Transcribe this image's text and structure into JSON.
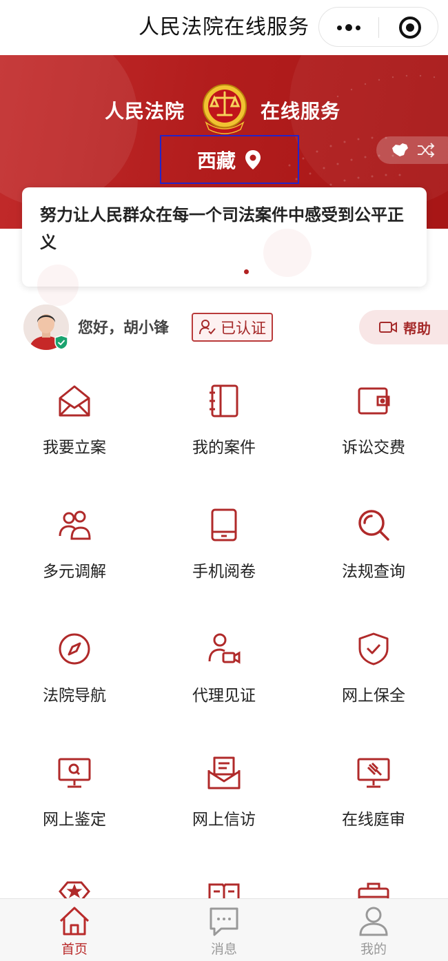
{
  "navbar": {
    "title": "人民法院在线服务"
  },
  "banner": {
    "title_left": "人民法院",
    "title_right": "在线服务",
    "location": "西藏"
  },
  "slogan": {
    "text": "努力让人民群众在每一个司法案件中感受到公平正义"
  },
  "user": {
    "greeting": "您好，胡小锋",
    "auth_status": "已认证",
    "help_label": "帮助"
  },
  "services": [
    {
      "label": "我要立案",
      "icon": "envelope-icon"
    },
    {
      "label": "我的案件",
      "icon": "notebook-icon"
    },
    {
      "label": "诉讼交费",
      "icon": "wallet-icon"
    },
    {
      "label": "多元调解",
      "icon": "people-icon"
    },
    {
      "label": "手机阅卷",
      "icon": "tablet-icon"
    },
    {
      "label": "法规查询",
      "icon": "magnifier-icon"
    },
    {
      "label": "法院导航",
      "icon": "compass-icon"
    },
    {
      "label": "代理见证",
      "icon": "person-video-icon"
    },
    {
      "label": "网上保全",
      "icon": "shield-check-icon"
    },
    {
      "label": "网上鉴定",
      "icon": "monitor-search-icon"
    },
    {
      "label": "网上信访",
      "icon": "mail-letter-icon"
    },
    {
      "label": "在线庭审",
      "icon": "gavel-screen-icon"
    }
  ],
  "tabbar": {
    "items": [
      {
        "label": "首页",
        "icon": "home-icon",
        "active": true
      },
      {
        "label": "消息",
        "icon": "message-icon",
        "active": false
      },
      {
        "label": "我的",
        "icon": "profile-icon",
        "active": false
      }
    ]
  },
  "colors": {
    "brand_red": "#b21d1d",
    "accent_red": "#b93a3a",
    "highlight_box": "#2424c8"
  }
}
